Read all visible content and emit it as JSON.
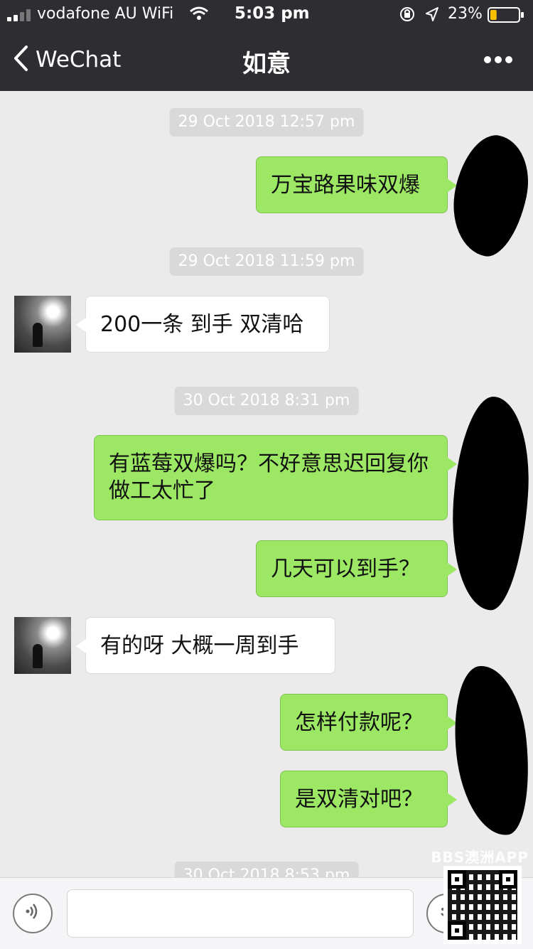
{
  "status_bar": {
    "carrier": "vodafone AU WiFi",
    "time": "5:03 pm",
    "battery_percent": "23%",
    "battery_level": 0.23
  },
  "nav": {
    "back_label": "WeChat",
    "title": "如意"
  },
  "messages": [
    {
      "type": "timestamp",
      "text": "29 Oct 2018 12:57 pm"
    },
    {
      "type": "outgoing",
      "text": "万宝路果味双爆"
    },
    {
      "type": "timestamp",
      "text": "29 Oct 2018 11:59 pm"
    },
    {
      "type": "incoming",
      "text": "200一条 到手 双清哈"
    },
    {
      "type": "timestamp",
      "text": "30 Oct 2018 8:31 pm"
    },
    {
      "type": "outgoing",
      "text": "有蓝莓双爆吗？不好意思迟回复你 做工太忙了"
    },
    {
      "type": "outgoing",
      "text": "几天可以到手？"
    },
    {
      "type": "incoming",
      "text": "有的呀 大概一周到手"
    },
    {
      "type": "outgoing",
      "text": "怎样付款呢？"
    },
    {
      "type": "outgoing",
      "text": "是双清对吧？"
    },
    {
      "type": "timestamp",
      "text": "30 Oct 2018 8:53 pm"
    }
  ],
  "watermark": "BBS澳洲APP",
  "colors": {
    "header_bg": "#2e2d32",
    "chat_bg": "#ebebeb",
    "outgoing_bubble": "#9ce864",
    "incoming_bubble": "#ffffff",
    "battery_fill": "#f5c000"
  }
}
